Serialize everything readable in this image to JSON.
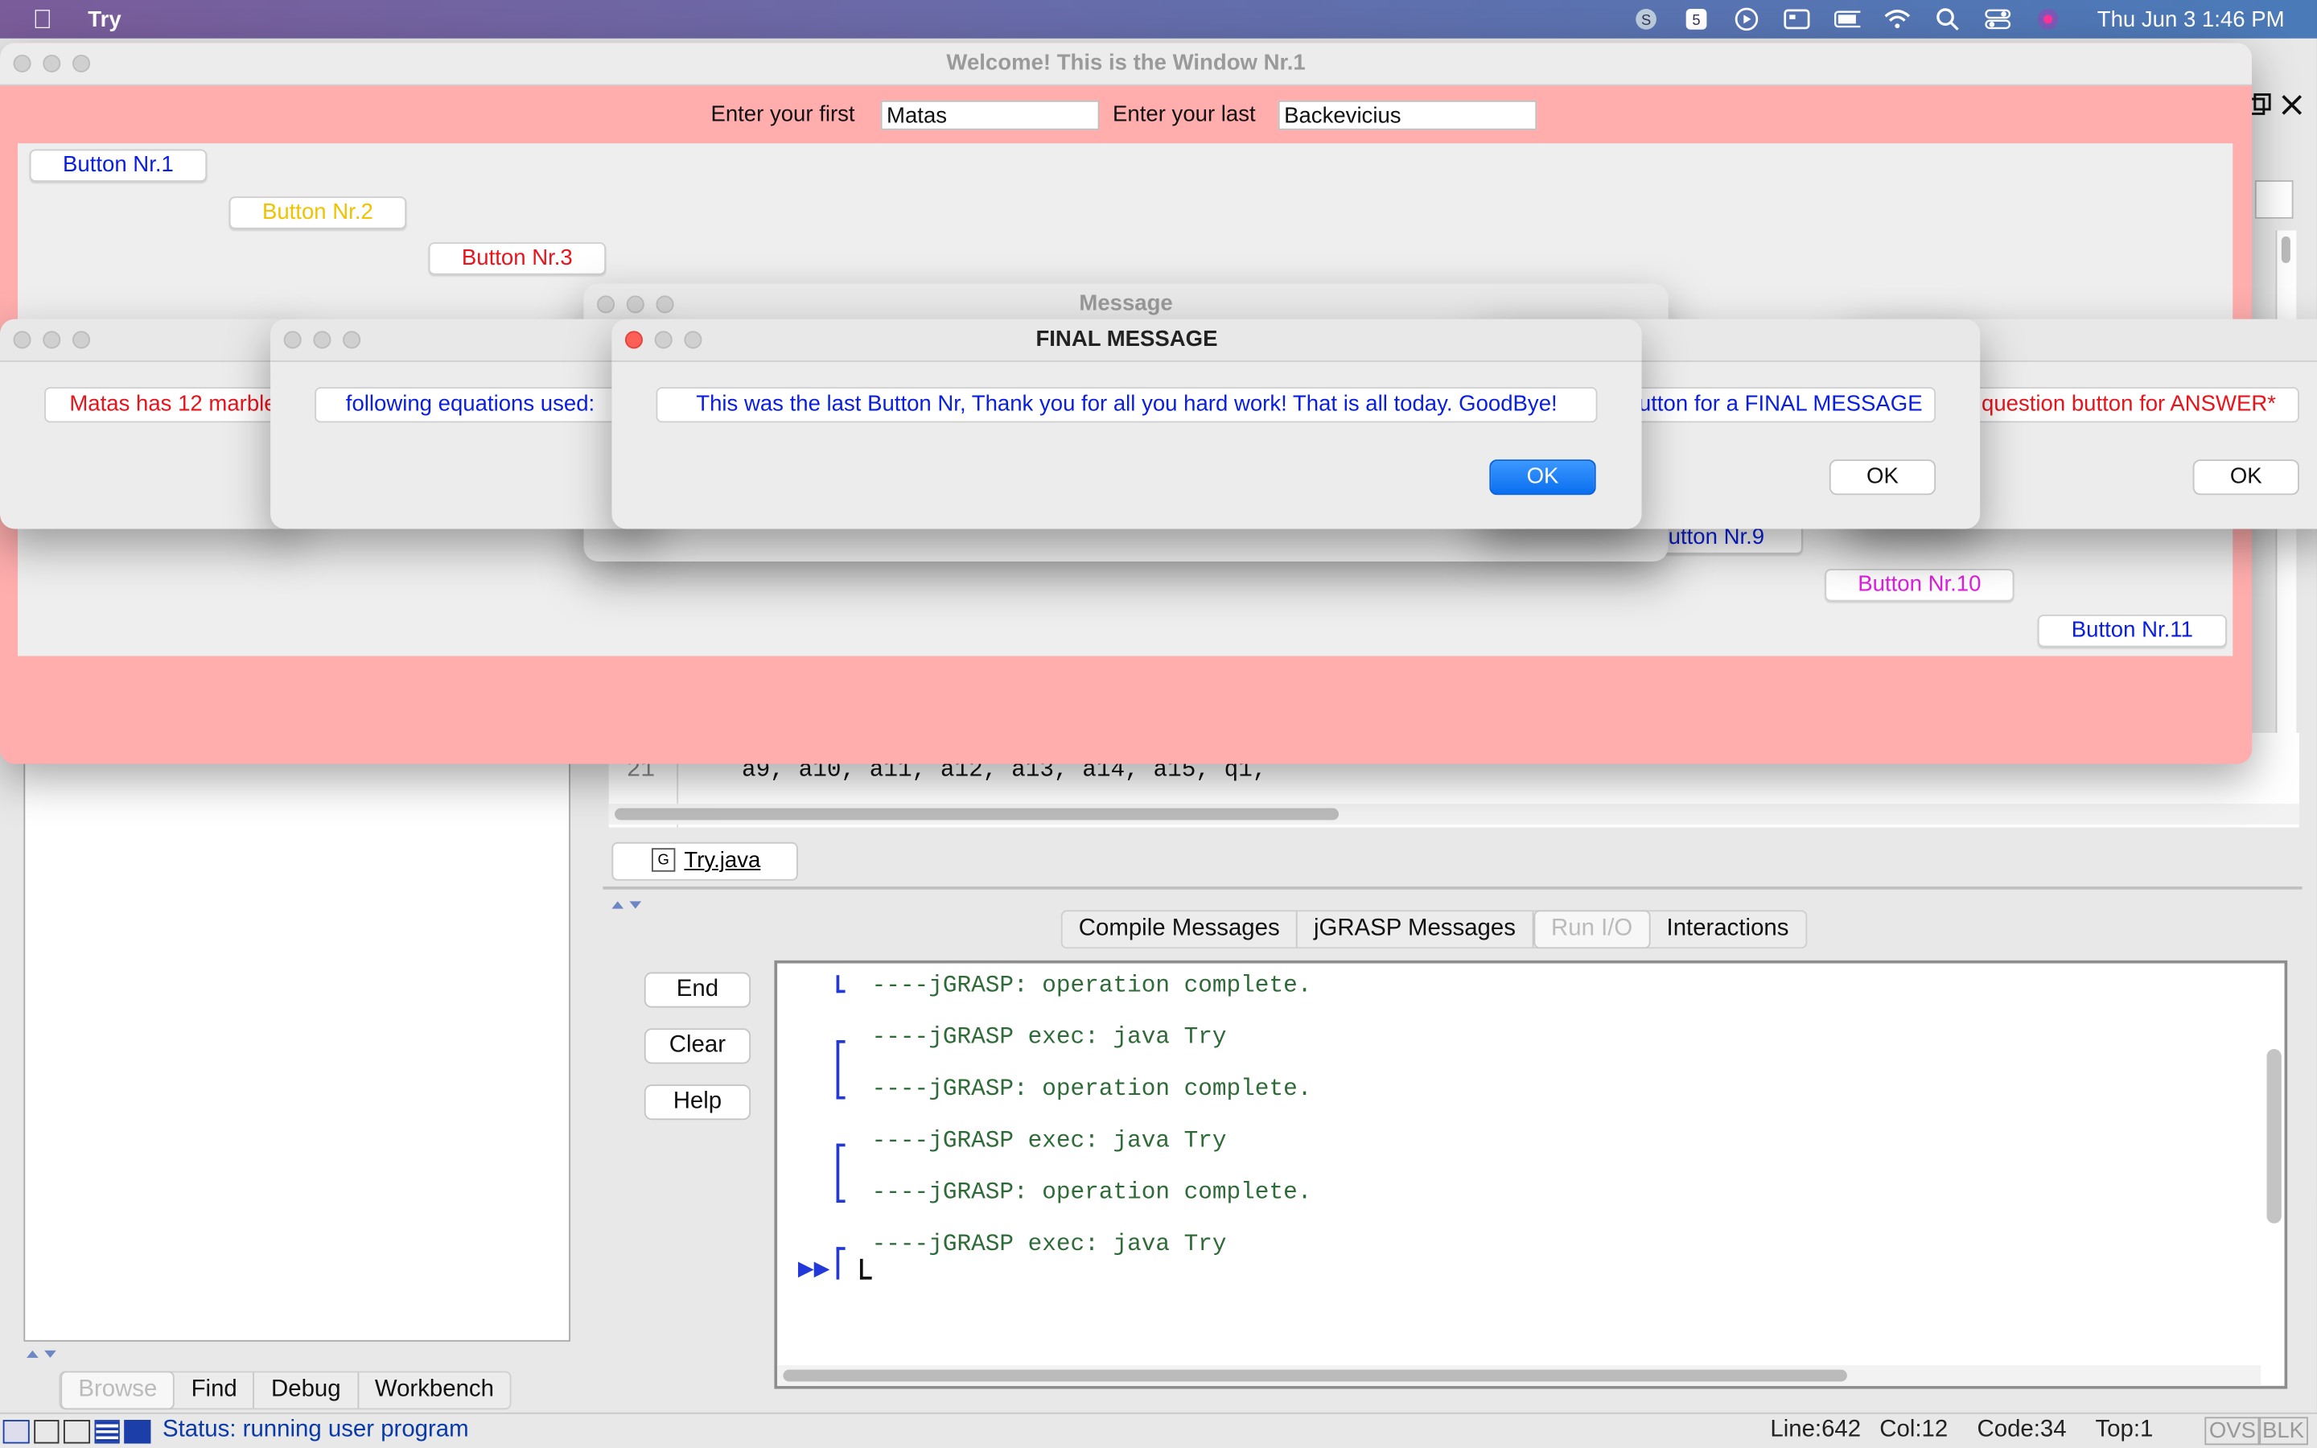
{
  "menubar": {
    "app_name": "Try",
    "clock": "Thu Jun 3  1:46 PM"
  },
  "jgrasp": {
    "side_tabs": [
      "Browse",
      "Find",
      "Debug",
      "Workbench"
    ],
    "file_tab": "Try.java",
    "code_line_number": "21",
    "code_line_text": "a9, a10, a11, a12, a13, a14, a15, q1,",
    "message_tabs": [
      "Compile Messages",
      "jGRASP Messages",
      "Run I/O",
      "Interactions"
    ],
    "buttons": {
      "end": "End",
      "clear": "Clear",
      "help": "Help"
    },
    "output": [
      "----jGRASP: operation complete.",
      "----jGRASP exec: java Try",
      "----jGRASP: operation complete.",
      "----jGRASP exec: java Try",
      "----jGRASP: operation complete.",
      "----jGRASP exec: java Try"
    ],
    "status": "Status: running user program",
    "statusbar": {
      "line": "Line:642",
      "col": "Col:12",
      "code": "Code:34",
      "top": "Top:1",
      "ovs": "OVS",
      "blk": "BLK"
    }
  },
  "main_window": {
    "title": "Welcome! This is the Window Nr.1",
    "first_label": "Enter your first",
    "first_value": "Matas",
    "last_label": "Enter your last",
    "last_value": "Backevicius",
    "buttons": {
      "b1": "Button Nr.1",
      "b2": "Button Nr.2",
      "b3": "Button Nr.3",
      "b9": "utton Nr.9",
      "b10": "Button Nr.10",
      "b11": "Button Nr.11"
    },
    "colors": {
      "blue": "#0a1ee0",
      "yellow": "#f2c200",
      "red": "#e8141c",
      "magenta": "#e020e0"
    }
  },
  "dialogs": {
    "message_title": "Message",
    "final_title": "FINAL MESSAGE",
    "final_text": "This was the last Button Nr, Thank you for all you hard work! That is all today. GoodBye!",
    "left1_text": "Matas has 12 marble",
    "left2_text": "following equations used:",
    "right1_text": "utton for a FINAL MESSAGE",
    "right2_text": "question button for ANSWER*",
    "ok": "OK"
  }
}
